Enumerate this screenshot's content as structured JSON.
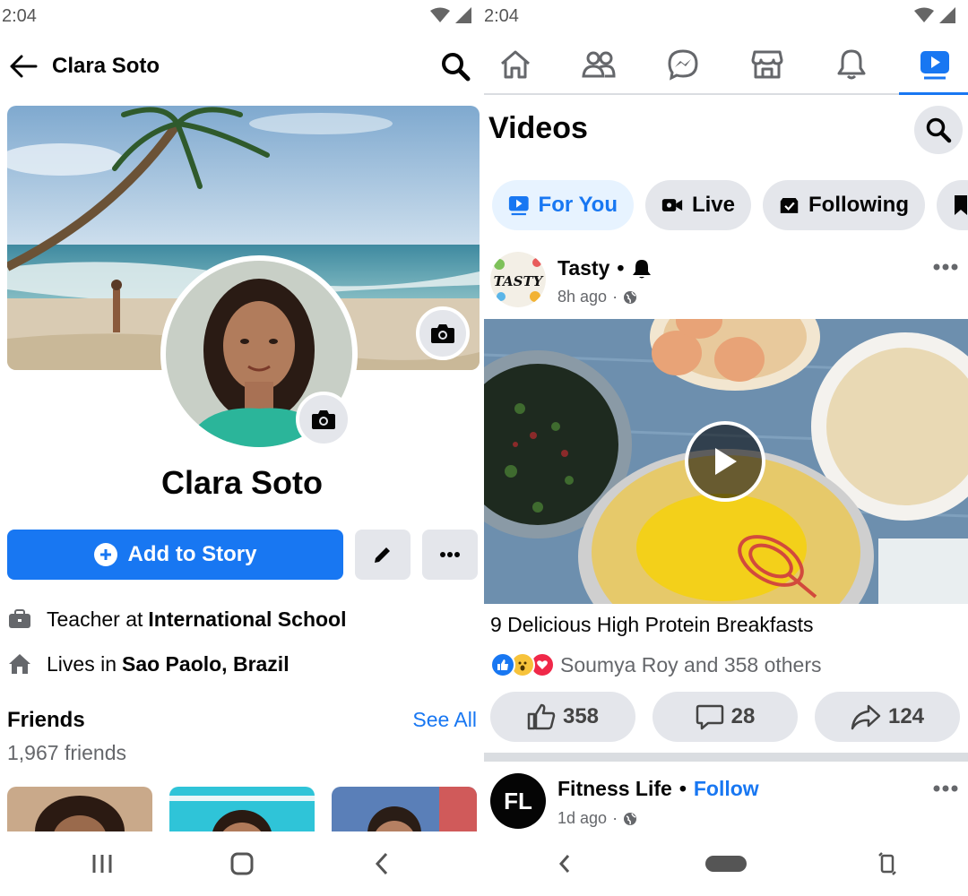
{
  "left": {
    "status_time": "2:04",
    "header": {
      "name": "Clara Soto"
    },
    "profile_name": "Clara Soto",
    "add_story_label": "Add to Story",
    "work": {
      "prefix": "Teacher at",
      "place": "International School"
    },
    "home": {
      "prefix": "Lives in",
      "place": "Sao Paolo, Brazil"
    },
    "friends": {
      "title": "Friends",
      "see_all": "See All",
      "count": "1,967 friends"
    }
  },
  "right": {
    "status_time": "2:04",
    "nav_tabs": [
      "home-icon",
      "friends-icon",
      "messenger-icon",
      "marketplace-icon",
      "notifications-icon",
      "watch-icon"
    ],
    "title": "Videos",
    "chips": [
      {
        "label": "For You",
        "icon": "play-icon",
        "active": true
      },
      {
        "label": "Live",
        "icon": "live-camera-icon",
        "active": false
      },
      {
        "label": "Following",
        "icon": "following-icon",
        "active": false
      }
    ],
    "post1": {
      "page": "Tasty",
      "avatar_text": "TASTY",
      "time": "8h ago",
      "video_title": "9 Delicious High Protein Breakfasts",
      "reactions_text": "Soumya Roy and 358 others",
      "likes": "358",
      "comments": "28",
      "shares": "124"
    },
    "post2": {
      "page": "Fitness Life",
      "avatar_text": "FL",
      "follow": "Follow",
      "time": "1d ago"
    }
  },
  "colors": {
    "accent": "#1877f2",
    "button_grey": "#e4e6eb",
    "secondary_text": "#65676b"
  }
}
